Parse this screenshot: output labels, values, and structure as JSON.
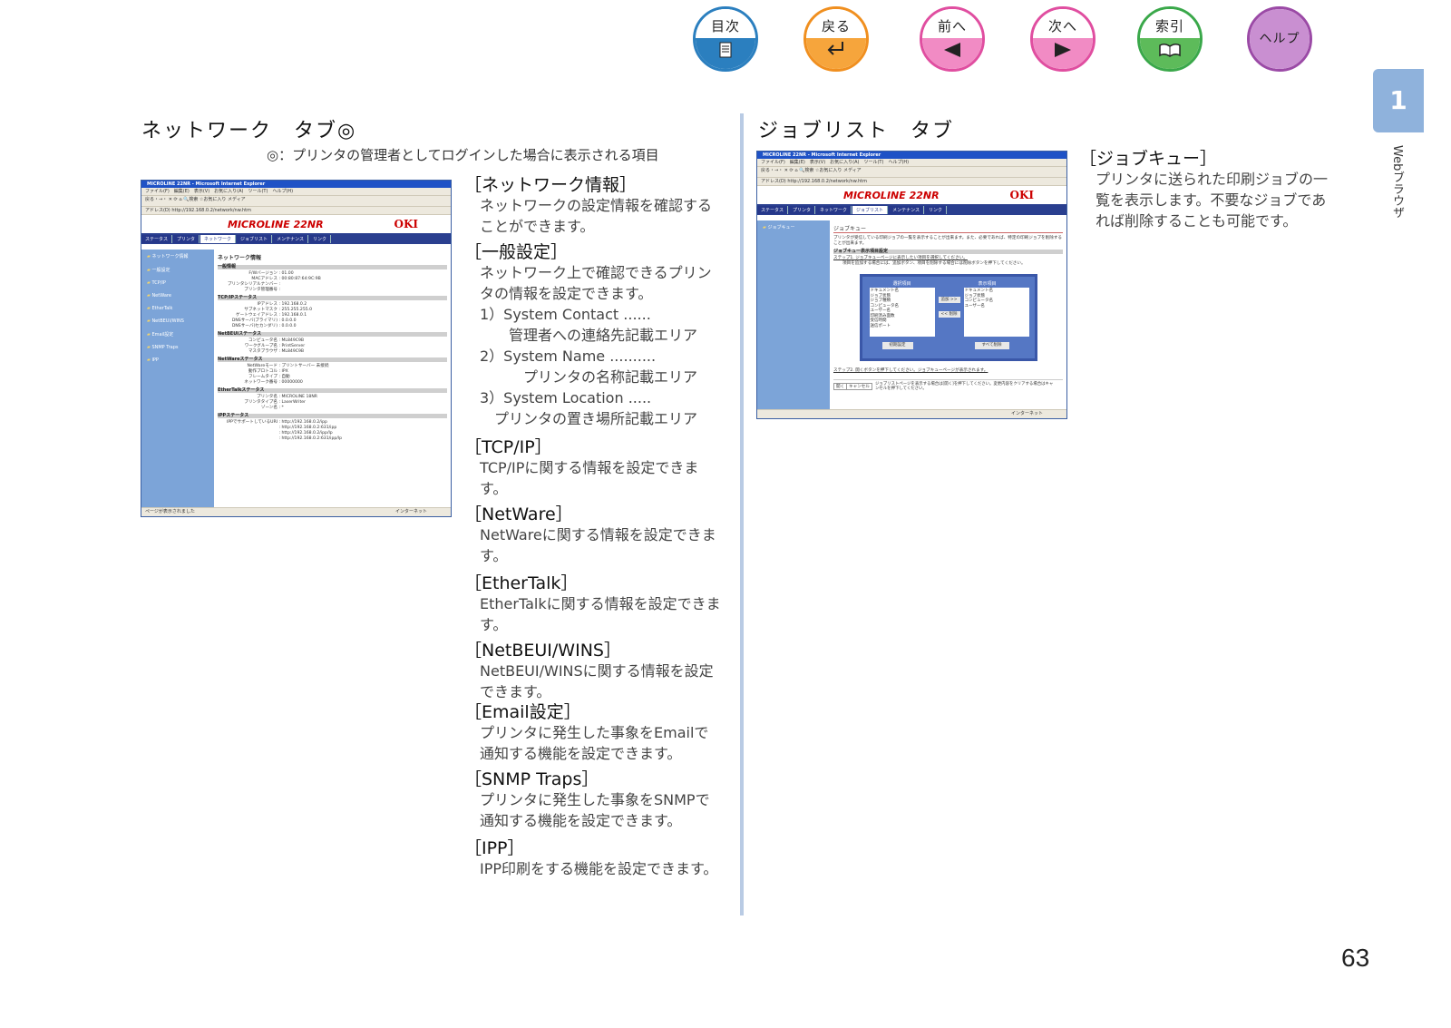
{
  "nav": [
    {
      "top": "目次",
      "icon": "list",
      "color": "#2b7fbf",
      "fill": "#2b7fbf"
    },
    {
      "top": "戻る",
      "icon": "return",
      "color": "#f08f1f",
      "fill": "#f6a53c"
    },
    {
      "top": "前へ",
      "icon": "prev",
      "color": "#e04ea0",
      "fill": "#f18bc4"
    },
    {
      "top": "次へ",
      "icon": "next",
      "color": "#e04ea0",
      "fill": "#f18bc4"
    },
    {
      "top": "索引",
      "icon": "book",
      "color": "#3aa84a",
      "fill": "#5dbb5a"
    },
    {
      "top": "ヘルプ",
      "icon": "",
      "color": "#9b4aa6",
      "fill": "#c98fd1"
    }
  ],
  "side_tab": {
    "number": "1",
    "label": "Webブラウザ"
  },
  "left": {
    "title": "ネットワーク　タブ◎",
    "note": "◎：プリンタの管理者としてログインした場合に表示される項目"
  },
  "right": {
    "title": "ジョブリスト　タブ"
  },
  "entries": [
    {
      "h": "［ネットワーク情報］",
      "b": [
        "ネットワークの設定情報を確認することができます。"
      ]
    },
    {
      "h": "［一般設定］",
      "b": [
        "ネットワーク上で確認できるプリンタの情報を設定できます。",
        "1）System Contact ......",
        "　　管理者への連絡先記載エリア",
        "2）System Name ..........",
        "　　　プリンタの名称記載エリア",
        "3）System Location .....",
        "　プリンタの置き場所記載エリア"
      ]
    },
    {
      "h": "［TCP/IP］",
      "b": [
        "TCP/IPに関する情報を設定できます。"
      ]
    },
    {
      "h": "［NetWare］",
      "b": [
        "NetWareに関する情報を設定できます。"
      ]
    },
    {
      "h": "［EtherTalk］",
      "b": [
        "EtherTalkに関する情報を設定できます。"
      ]
    },
    {
      "h": "［NetBEUI/WINS］",
      "b": [
        "NetBEUI/WINSに関する情報を設定できます。"
      ]
    },
    {
      "h": "［Email設定］",
      "b": [
        "プリンタに発生した事象をEmailで通知する機能を設定できます。"
      ]
    },
    {
      "h": "［SNMP Traps］",
      "b": [
        "プリンタに発生した事象をSNMPで通知する機能を設定できます。"
      ]
    },
    {
      "h": "［IPP］",
      "b": [
        "IPP印刷をする機能を設定できます。"
      ]
    }
  ],
  "job_entry": {
    "h": "［ジョブキュー］",
    "b": "プリンタに送られた印刷ジョブの一覧を表示します。不要なジョブであれば削除することも可能です。"
  },
  "screenshot1": {
    "title": "MICROLINE 22NR - Microsoft Internet Explorer",
    "menu": "ファイル(F)　編集(E)　表示(V)　お気に入り(A)　ツール(T)　ヘルプ(H)",
    "tool": "戻る・→・ ✕ ⟳ ⌂ 🔍検索 ☆お気に入り メディア",
    "addr": "アドレス(D)  http://192.168.0.2/network/nw.htm",
    "product": "MICROLINE 22NR",
    "logo": "OKI",
    "tabs": [
      "ステータス",
      "プリンタ",
      "ネットワーク",
      "ジョブリスト",
      "メンテナンス",
      "リンク"
    ],
    "side": [
      "ネットワーク情報",
      "一般設定",
      "TCP/IP",
      "NetWare",
      "EtherTalk",
      "NetBEUI/WINS",
      "Email設定",
      "SNMP Traps",
      "IPP"
    ],
    "heading": "ネットワーク情報",
    "sections": [
      {
        "name": "一般情報",
        "rows": [
          [
            "F/Wバージョン",
            "01.00"
          ],
          [
            "MACアドレス",
            "00:80:87:64:9C:9B"
          ],
          [
            "プリンタシリアルナンバー",
            ""
          ],
          [
            "プリンタ管理番号",
            ""
          ]
        ]
      },
      {
        "name": "TCP/IPステータス",
        "rows": [
          [
            "IPアドレス",
            "192.168.0.2"
          ],
          [
            "サブネットマスク",
            "255.255.255.0"
          ],
          [
            "ゲートウェイアドレス",
            "192.168.0.1"
          ],
          [
            "DNSサーバ(プライマリ)",
            "0.0.0.0"
          ],
          [
            "DNSサーバ(セカンダリ)",
            "0.0.0.0"
          ]
        ]
      },
      {
        "name": "NetBEUIステータス",
        "rows": [
          [
            "コンピュータ名",
            "ML849C9B"
          ],
          [
            "ワークグループ名",
            "PrintServer"
          ],
          [
            "マスタブラウザ",
            "ML849C9B"
          ]
        ]
      },
      {
        "name": "NetWareステータス",
        "rows": [
          [
            "NetWareモード",
            "プリントサーバー 未接続"
          ],
          [
            "動作プロトコル",
            "IPX"
          ],
          [
            "フレームタイプ",
            "自動"
          ],
          [
            "ネットワーク番号",
            "00000000"
          ]
        ]
      },
      {
        "name": "EtherTalkステータス",
        "rows": [
          [
            "プリンタ名",
            "MICROLINE 18NR"
          ],
          [
            "プリンタタイプ名",
            "LaserWriter"
          ],
          [
            "ゾーン名",
            "*"
          ]
        ]
      },
      {
        "name": "IPPステータス",
        "rows": [
          [
            "IPPでサポートしているURI",
            "http://192.168.0.2/ipp"
          ],
          [
            "",
            "http://192.168.0.2:631/ipp"
          ],
          [
            "",
            "http://192.168.0.2/ipp/lp"
          ],
          [
            "",
            "http://192.168.0.2:631/ipp/lp"
          ]
        ]
      }
    ],
    "status": "ページが表示されました",
    "zone": "インターネット"
  },
  "screenshot2": {
    "title": "MICROLINE 22NR - Microsoft Internet Explorer",
    "menu": "ファイル(F)　編集(E)　表示(V)　お気に入り(A)　ツール(T)　ヘルプ(H)",
    "tool": "戻る・→・ ✕ ⟳ ⌂ 🔍検索 ☆お気に入り メディア",
    "addr": "アドレス(D)  http://192.168.0.2/network/nw.htm",
    "product": "MICROLINE 22NR",
    "logo": "OKI",
    "tabs": [
      "ステータス",
      "プリンタ",
      "ネットワーク",
      "ジョブリスト",
      "メンテナンス",
      "リンク"
    ],
    "side": [
      "ジョブキュー"
    ],
    "heading": "ジョブキュー",
    "desc": "プリンタが受信している印刷ジョブの一覧を表示することが出来ます。また、必要であれば、特定の印刷ジョブを削除することが出来ます。",
    "bar": "ジョブキュー表示項目設定",
    "step1": "ステップ1. ジョブキューページに表示したい項目を選択してください。",
    "step1b": "項目を追加する場合には、追加ボタン、項目を削除する場合には削除ボタンを押下してください。",
    "sel_label": "選択項目",
    "disp_label": "表示項目",
    "sel_items": [
      "ドキュメント名",
      "ジョブ状態",
      "ジョブ種類",
      "コンピュータ名",
      "ユーザー名",
      "印刷済み面数",
      "受信時間",
      "送信ポート"
    ],
    "disp_items": [
      "ドキュメント名",
      "ジョブ状態",
      "コンピュータ名",
      "ユーザー名"
    ],
    "add": "追加 >>",
    "del": "<< 削除",
    "init": "初期設定",
    "delall": "すべて削除",
    "step2": "ステップ2. 開くボタンを押下してください。ジョブキューページが表示されます。",
    "open": "開く",
    "cancel": "キャンセル",
    "note": "ジョブリストページを表示する場合は[開く]を押下してください。変更内容をクリアする場合はキャンセルを押下してください。",
    "zone": "インターネット"
  },
  "page_number": "63"
}
